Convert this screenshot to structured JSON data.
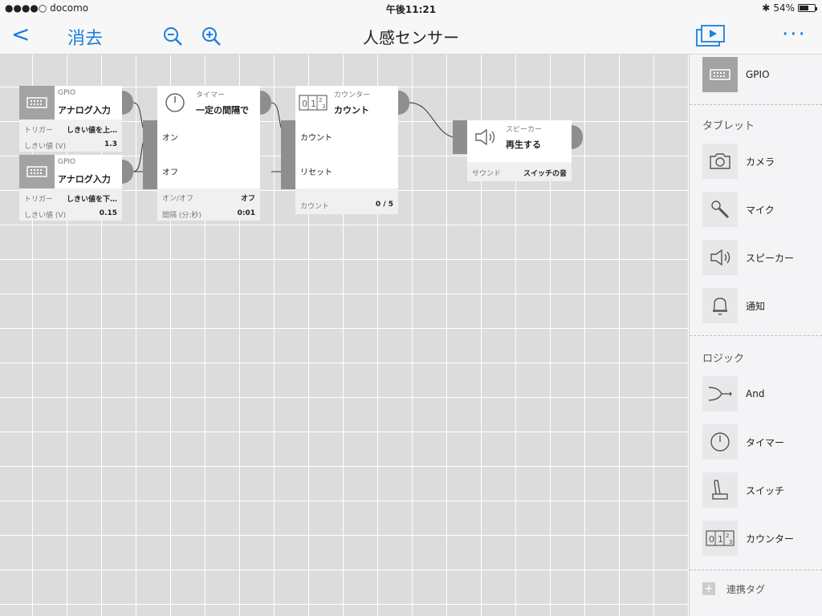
{
  "status": {
    "carrier": "●●●●○ docomo",
    "time": "午後11:21",
    "battery": "54%"
  },
  "nav": {
    "back": "<",
    "clear": "消去",
    "title": "人感センサー",
    "more": "···"
  },
  "nodes": {
    "gpio1": {
      "kind": "GPIO",
      "label": "アナログ入力",
      "trigger_k": "トリガー",
      "trigger_v": "しきい値を上…",
      "thr_k": "しきい値 (V)",
      "thr_v": "1.3"
    },
    "gpio2": {
      "kind": "GPIO",
      "label": "アナログ入力",
      "trigger_k": "トリガー",
      "trigger_v": "しきい値を下…",
      "thr_k": "しきい値 (V)",
      "thr_v": "0.15"
    },
    "timer": {
      "kind": "タイマー",
      "label": "一定の間隔で",
      "in1": "オン",
      "in2": "オフ",
      "onoff_k": "オン/オフ",
      "onoff_v": "オフ",
      "int_k": "間隔 (分:秒)",
      "int_v": "0:01"
    },
    "counter": {
      "kind": "カウンター",
      "label": "カウント",
      "in1": "カウント",
      "in2": "リセット",
      "cnt_k": "カウント",
      "cnt_v": "0 / 5"
    },
    "speaker": {
      "kind": "スピーカー",
      "label": "再生する",
      "snd_k": "サウンド",
      "snd_v": "スイッチの音"
    }
  },
  "sidebar": {
    "top_item": "GPIO",
    "section_tablet": "タブレット",
    "tablet": [
      "カメラ",
      "マイク",
      "スピーカー",
      "通知"
    ],
    "section_logic": "ロジック",
    "logic": [
      "And",
      "タイマー",
      "スイッチ",
      "カウンター"
    ],
    "tag": "連携タグ"
  },
  "colors": {
    "accent": "#1a7fdc",
    "icon_gray": "#a3a3a3",
    "grid_bg": "#dcdcdd"
  }
}
